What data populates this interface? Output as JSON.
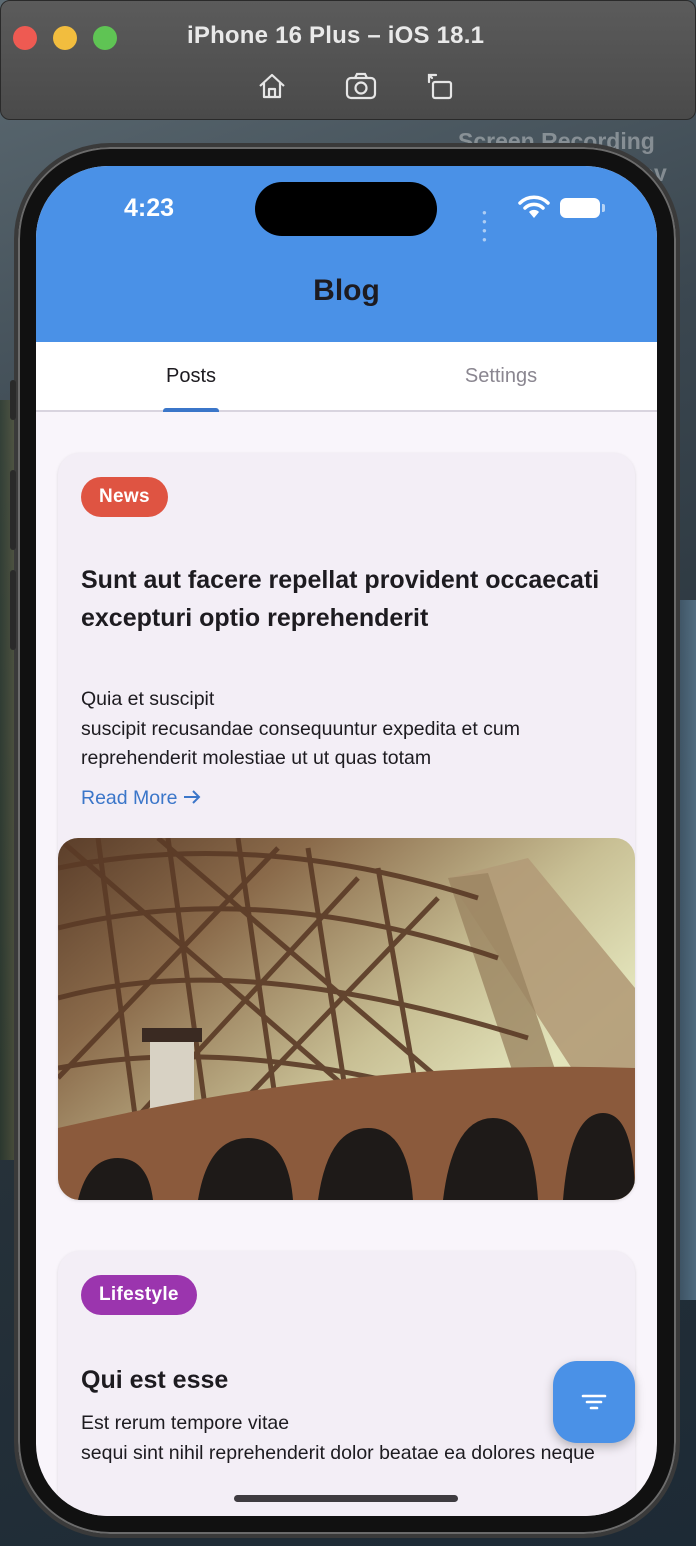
{
  "simulator": {
    "title": "iPhone 16 Plus – iOS 18.1",
    "tools": [
      "home-icon",
      "screenshot-icon",
      "rotate-icon"
    ],
    "recording_label": "Screen Recording",
    "recording_label_tail": "ov"
  },
  "status_bar": {
    "time": "4:23"
  },
  "app_bar": {
    "title": "Blog",
    "color": "#4a91e7"
  },
  "tabs": [
    {
      "label": "Posts",
      "selected": true
    },
    {
      "label": "Settings",
      "selected": false
    }
  ],
  "posts": [
    {
      "category": "News",
      "category_color": "#df5442",
      "title": "Sunt aut facere repellat provident occaecati excepturi optio reprehenderit",
      "body": "Quia et suscipit\nsuscipit recusandae consequuntur expedita et cum reprehenderit molestiae ut ut quas totam",
      "read_more": "Read More",
      "image": "bridge-photo"
    },
    {
      "category": "Lifestyle",
      "category_color": "#9b35ae",
      "title": "Qui est esse",
      "body": "Est rerum tempore vitae\nsequi sint nihil reprehenderit dolor beatae ea dolores neque"
    }
  ],
  "fab": {
    "icon": "filter-icon"
  }
}
